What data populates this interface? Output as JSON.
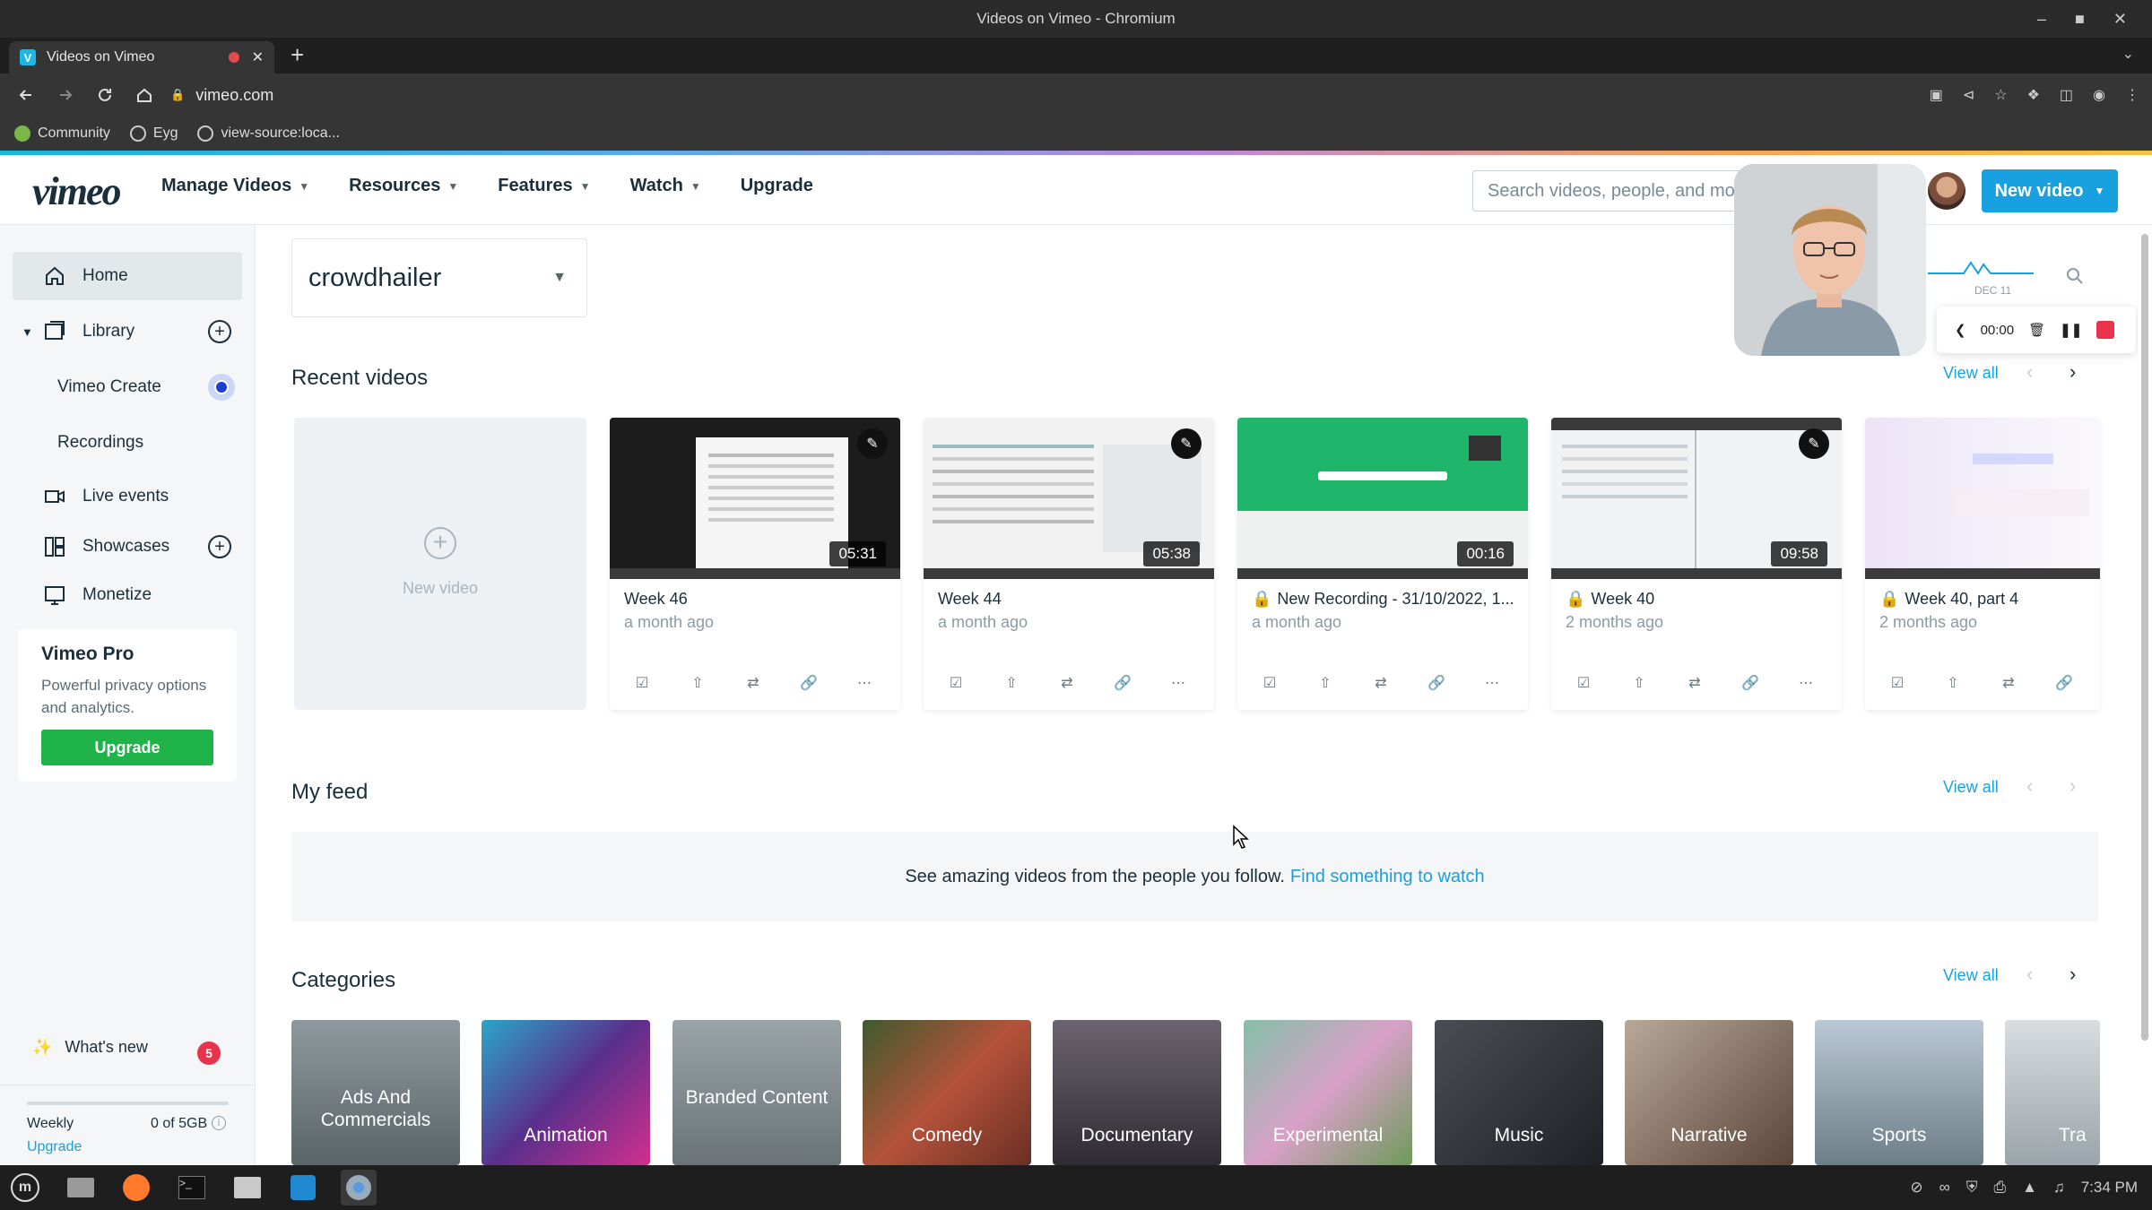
{
  "window": {
    "title": "Videos on Vimeo - Chromium"
  },
  "browser": {
    "tab_title": "Videos on Vimeo",
    "favicon": "V",
    "url": "vimeo.com",
    "bookmarks": [
      "Community",
      "Eyg",
      "view-source:loca..."
    ]
  },
  "header": {
    "logo": "vimeo",
    "nav": [
      "Manage Videos",
      "Resources",
      "Features",
      "Watch",
      "Upgrade"
    ],
    "search_placeholder": "Search videos, people, and mo",
    "new_video": "New video"
  },
  "sidebar": {
    "items": [
      {
        "label": "Home",
        "icon": "home-icon"
      },
      {
        "label": "Library",
        "icon": "library-icon"
      },
      {
        "label": "Vimeo Create",
        "icon": "create-icon"
      },
      {
        "label": "Recordings",
        "icon": ""
      },
      {
        "label": "Live events",
        "icon": "camera-icon"
      },
      {
        "label": "Showcases",
        "icon": "showcase-icon"
      },
      {
        "label": "Monetize",
        "icon": "monetize-icon"
      }
    ],
    "pro": {
      "title": "Vimeo Pro",
      "desc": "Powerful privacy options and analytics.",
      "button": "Upgrade"
    },
    "whats_new": "What's new",
    "whats_new_count": "5",
    "storage": {
      "period": "Weekly",
      "value": "0 of 5GB",
      "upgrade": "Upgrade",
      "used_fraction": 0
    }
  },
  "main": {
    "team": "crowdhailer",
    "recent": {
      "title": "Recent videos",
      "view_all": "View all",
      "new_video_label": "New video",
      "videos": [
        {
          "title": "Week 46",
          "time": "a month ago",
          "duration": "05:31",
          "locked": false
        },
        {
          "title": "Week 44",
          "time": "a month ago",
          "duration": "05:38",
          "locked": false
        },
        {
          "title": "New Recording - 31/10/2022, 1...",
          "time": "a month ago",
          "duration": "00:16",
          "locked": true
        },
        {
          "title": "Week 40",
          "time": "2 months ago",
          "duration": "09:58",
          "locked": true
        },
        {
          "title": "Week 40, part 4",
          "time": "2 months ago",
          "duration": "",
          "locked": true
        }
      ]
    },
    "feed": {
      "title": "My feed",
      "view_all": "View all",
      "message": "See amazing videos from the people you follow.",
      "link": "Find something to watch"
    },
    "categories": {
      "title": "Categories",
      "view_all": "View all",
      "items": [
        "Ads And Commercials",
        "Animation",
        "Branded Content",
        "Comedy",
        "Documentary",
        "Experimental",
        "Music",
        "Narrative",
        "Sports",
        "Tra"
      ]
    }
  },
  "recorder": {
    "time": "00:00",
    "date_label": "DEC 11"
  },
  "taskbar": {
    "time": "7:34 PM"
  },
  "colors": {
    "accent": "#17a1e0",
    "upgrade": "#1fb34a",
    "badge": "#e8334a"
  }
}
